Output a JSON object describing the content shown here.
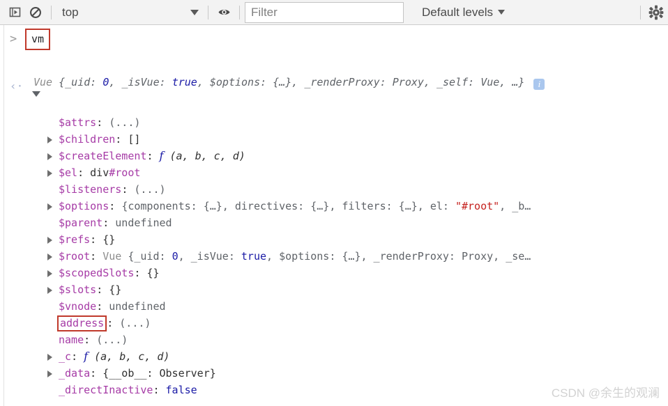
{
  "toolbar": {
    "sidebar_toggle_icon": "console-sidebar-icon",
    "clear_console_icon": "clear-console-icon",
    "context_label": "top",
    "eye_icon": "live-expression-eye-icon",
    "filter_placeholder": "Filter",
    "filter_value": "",
    "levels_label": "Default levels",
    "settings_icon": "gear-icon"
  },
  "console": {
    "prompt_symbol": ">",
    "input_expression": "vm",
    "return_symbol": "‹·",
    "result_header": {
      "class_name": "Vue",
      "open_brace": "{",
      "parts": [
        {
          "text": "_uid: ",
          "kind": "key-inline"
        },
        {
          "text": "0",
          "kind": "num"
        },
        {
          "text": ", _isVue: ",
          "kind": "key-inline"
        },
        {
          "text": "true",
          "kind": "bool"
        },
        {
          "text": ", $options: {…}, _renderProxy: Proxy, _self: Vue, …}",
          "kind": "plain"
        }
      ],
      "full_text": "Vue {_uid: 0, _isVue: true, $options: {…}, _renderProxy: Proxy, _self: Vue, …}",
      "info_badge": "i"
    },
    "properties": [
      {
        "expandable": false,
        "key": "$attrs",
        "sep": ": ",
        "value": "(...)",
        "value_kind": "dim"
      },
      {
        "expandable": true,
        "key": "$children",
        "sep": ": ",
        "value": "[]",
        "value_kind": "plain"
      },
      {
        "expandable": true,
        "key": "$createElement",
        "sep": ": ",
        "value": "f (a, b, c, d)",
        "value_kind": "function"
      },
      {
        "expandable": true,
        "key": "$el",
        "sep": ": ",
        "value": "div#root",
        "value_kind": "node"
      },
      {
        "expandable": false,
        "key": "$listeners",
        "sep": ": ",
        "value": "(...)",
        "value_kind": "dim"
      },
      {
        "expandable": true,
        "key": "$options",
        "sep": ": ",
        "value": "{components: {…}, directives: {…}, filters: {…}, el: \"#root\", _b…",
        "value_kind": "options"
      },
      {
        "expandable": false,
        "key": "$parent",
        "sep": ": ",
        "value": "undefined",
        "value_kind": "dim"
      },
      {
        "expandable": true,
        "key": "$refs",
        "sep": ": ",
        "value": "{}",
        "value_kind": "plain"
      },
      {
        "expandable": true,
        "key": "$root",
        "sep": ": ",
        "value": "Vue {_uid: 0, _isVue: true, $options: {…}, _renderProxy: Proxy, _se…",
        "value_kind": "root"
      },
      {
        "expandable": true,
        "key": "$scopedSlots",
        "sep": ": ",
        "value": "{}",
        "value_kind": "plain"
      },
      {
        "expandable": true,
        "key": "$slots",
        "sep": ": ",
        "value": "{}",
        "value_kind": "plain"
      },
      {
        "expandable": false,
        "key": "$vnode",
        "sep": ": ",
        "value": "undefined",
        "value_kind": "dim"
      },
      {
        "expandable": false,
        "key": "address",
        "sep": ": ",
        "value": "(...)",
        "value_kind": "dim",
        "highlighted": true
      },
      {
        "expandable": false,
        "key": "name",
        "sep": ": ",
        "value": "(...)",
        "value_kind": "dim"
      },
      {
        "expandable": true,
        "key": "_c",
        "sep": ": ",
        "value": "f (a, b, c, d)",
        "value_kind": "function"
      },
      {
        "expandable": true,
        "key": "_data",
        "sep": ": ",
        "value": "{__ob__: Observer}",
        "value_kind": "plain"
      },
      {
        "expandable": false,
        "key": "_directInactive",
        "sep": ": ",
        "value": "false",
        "value_kind": "bool"
      }
    ]
  },
  "watermark": "CSDN @余生的观澜",
  "colors": {
    "key_purple": "#a63ba6",
    "number_blue": "#1a1aa6",
    "string_red": "#c5221f",
    "annotation_red": "#c0392b",
    "toolbar_bg": "#f3f3f3",
    "info_badge_blue": "#aac7ee"
  }
}
